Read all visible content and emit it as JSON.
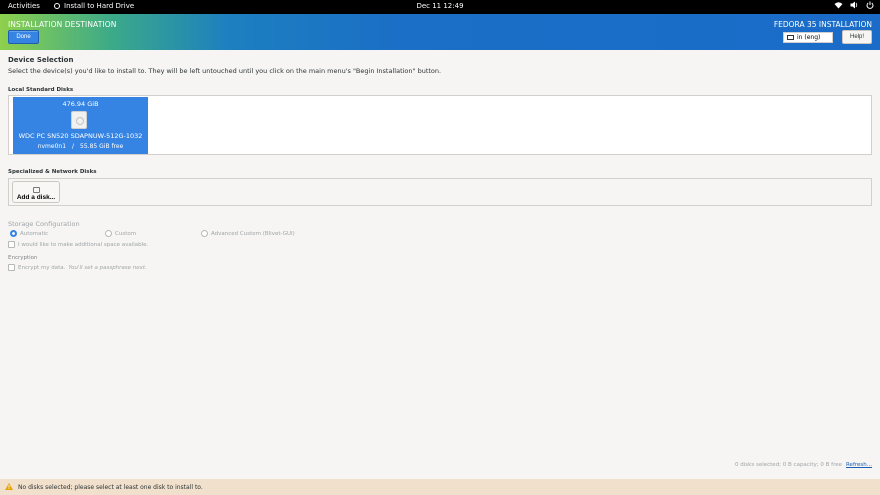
{
  "topbar": {
    "activities": "Activities",
    "app_name": "Install to Hard Drive",
    "clock": "Dec 11  12:49",
    "status_icons": [
      "network-wifi-icon",
      "volume-icon",
      "power-icon"
    ]
  },
  "header": {
    "title": "INSTALLATION DESTINATION",
    "done_label": "Done",
    "product": "FEDORA 35 INSTALLATION",
    "keyboard_layout": "in (eng)",
    "help_label": "Help!"
  },
  "device_selection": {
    "heading": "Device Selection",
    "instruction": "Select the device(s) you'd like to install to.  They will be left untouched until you click on the main menu's \"Begin Installation\" button.",
    "local_label": "Local Standard Disks",
    "disks": [
      {
        "size": "476.94 GiB",
        "model": "WDC PC SN520 SDAPNUW-512G-1032",
        "device": "nvme0n1",
        "separator": "/",
        "free": "55.85 GiB free"
      }
    ],
    "specialized_label": "Specialized & Network Disks",
    "add_disk_label": "Add a disk..."
  },
  "storage_configuration": {
    "title": "Storage Configuration",
    "options": [
      {
        "label": "Automatic",
        "selected": true
      },
      {
        "label": "Custom",
        "selected": false
      },
      {
        "label": "Advanced Custom (Blivet-GUI)",
        "selected": false
      }
    ],
    "additional_space": "I would like to make additional space available."
  },
  "encryption": {
    "title": "Encryption",
    "encrypt_label": "Encrypt my data.",
    "encrypt_hint": "You'll set a passphrase next."
  },
  "summary": {
    "text": "0 disks selected; 0 B capacity; 0 B free",
    "refresh_label": "Refresh..."
  },
  "warning": {
    "text": "No disks selected; please select at least one disk to install to."
  },
  "colors": {
    "accent": "#3584e4",
    "header_gradient_start": "#8ed04d",
    "header_gradient_end": "#1a6cc8",
    "warning_bar": "#f0e0cc"
  }
}
